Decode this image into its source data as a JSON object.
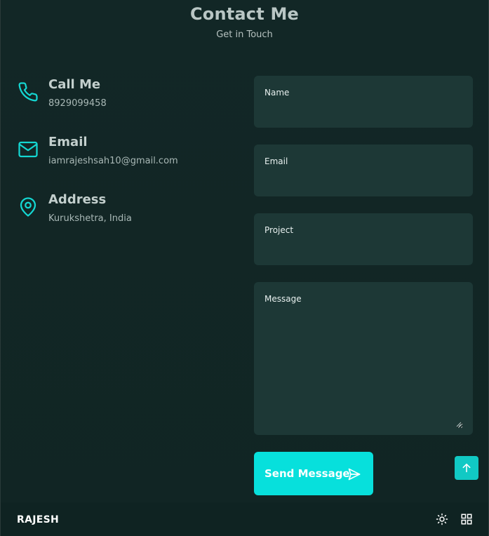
{
  "header": {
    "title": "Contact Me",
    "subtitle": "Get in Touch"
  },
  "contact_info": [
    {
      "label": "Call Me",
      "value": "8929099458",
      "icon": "phone-icon"
    },
    {
      "label": "Email",
      "value": "iamrajeshsah10@gmail.com",
      "icon": "mail-icon"
    },
    {
      "label": "Address",
      "value": "Kurukshetra, India",
      "icon": "map-pin-icon"
    }
  ],
  "form": {
    "name_label": "Name",
    "name_value": "",
    "email_label": "Email",
    "email_value": "",
    "project_label": "Project",
    "project_value": "",
    "message_label": "Message",
    "message_value": "",
    "send_label": "Send Message",
    "send_icon": "send-icon"
  },
  "footer": {
    "brand": "RAJESH",
    "theme_icon": "sun-icon",
    "menu_icon": "grid-icon"
  },
  "scroll_top_icon": "arrow-up-icon",
  "colors": {
    "accent": "#07e0dc",
    "icon": "#14d7d2",
    "background": "#122726",
    "field": "#1d3836",
    "footer": "#0f2322"
  }
}
